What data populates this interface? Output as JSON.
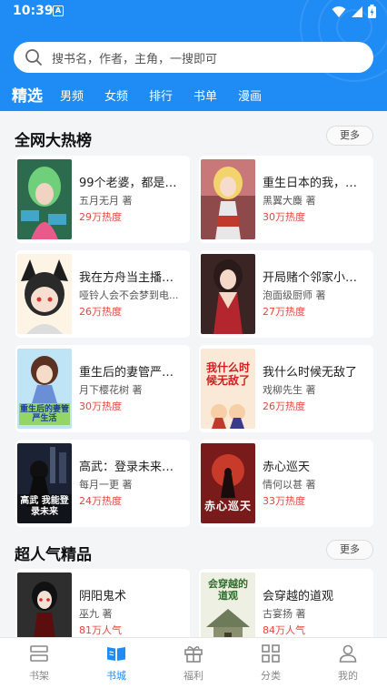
{
  "status_bar": {
    "time": "10:39",
    "notif_glyph": "A"
  },
  "search": {
    "placeholder": "搜书名，作者，主角，一搜即可"
  },
  "tabs": [
    "精选",
    "男频",
    "女频",
    "排行",
    "书单",
    "漫画"
  ],
  "sections": [
    {
      "title": "全网大热榜",
      "more_label": "更多",
      "books": [
        {
          "title": "99个老婆，都是我...",
          "author": "五月无月 著",
          "heat": "29万热度"
        },
        {
          "title": "重生日本的我，在...",
          "author": "黑翼大麋 著",
          "heat": "30万热度"
        },
        {
          "title": "我在方舟当主播，...",
          "author": "哑铃人会不会梦到电...",
          "heat": "26万热度"
        },
        {
          "title": "开局赌个邻家小姐...",
          "author": "泡面级厨师 著",
          "heat": "27万热度"
        },
        {
          "title": "重生后的妻管严生...",
          "author": "月下樱花树 著",
          "heat": "30万热度"
        },
        {
          "title": "我什么时候无敌了",
          "author": "戏柳先生 著",
          "heat": "26万热度"
        },
        {
          "title": "高武：登录未来一...",
          "author": "每月一更 著",
          "heat": "24万热度"
        },
        {
          "title": "赤心巡天",
          "author": "情何以甚 著",
          "heat": "33万热度"
        }
      ]
    },
    {
      "title": "超人气精品",
      "more_label": "更多",
      "books": [
        {
          "title": "阴阳鬼术",
          "author": "巫九 著",
          "heat": "81万人气"
        },
        {
          "title": "会穿越的道观",
          "author": "古宴扬 著",
          "heat": "84万人气"
        }
      ]
    }
  ],
  "cover_texts": {
    "c5": "重生后的妻管严生活",
    "c6": "我什么时候无敌了",
    "c7": "高武 我能登录未来",
    "c8": "赤心巡天",
    "c10": "会穿越的道观"
  },
  "bottom_nav": [
    {
      "label": "书架",
      "icon": "bookshelf-icon"
    },
    {
      "label": "书城",
      "icon": "bookstore-icon",
      "active": true
    },
    {
      "label": "福利",
      "icon": "gift-icon"
    },
    {
      "label": "分类",
      "icon": "category-grid-icon"
    },
    {
      "label": "我的",
      "icon": "person-icon"
    }
  ],
  "colors": {
    "accent": "#1f8bf5",
    "heat": "#e8453c",
    "background": "#f4f5f7"
  }
}
